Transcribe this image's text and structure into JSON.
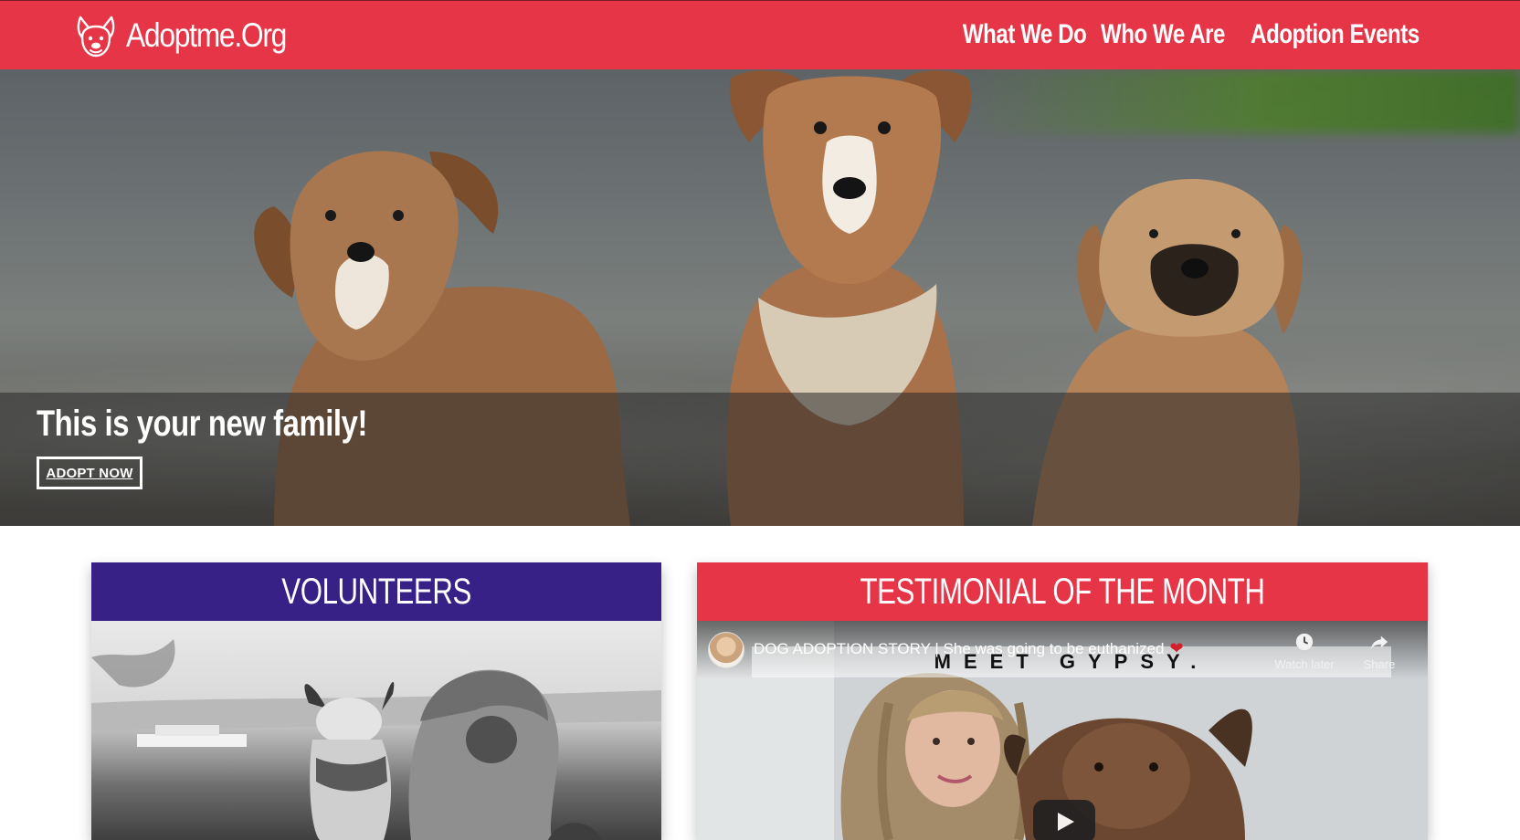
{
  "header": {
    "brand": "Adoptme.Org",
    "brand_icon": "dog-face-icon",
    "nav": [
      {
        "label": "What We Do"
      },
      {
        "label": "Who We Are"
      },
      {
        "label": "Adoption Events"
      }
    ],
    "colors": {
      "bar": "#e63546"
    }
  },
  "hero": {
    "title": "This is your new family!",
    "cta": "ADOPT NOW"
  },
  "volunteers": {
    "heading": "VOLUNTEERS",
    "color": "#372086"
  },
  "testimonial": {
    "heading": "TESTIMONIAL OF THE MONTH",
    "color": "#e63546",
    "video": {
      "title": "DOG ADOPTION STORY | She was going to be euthanized",
      "overlay_text": "MEET GYPSY.",
      "watch_later": "Watch later",
      "share": "Share"
    }
  }
}
